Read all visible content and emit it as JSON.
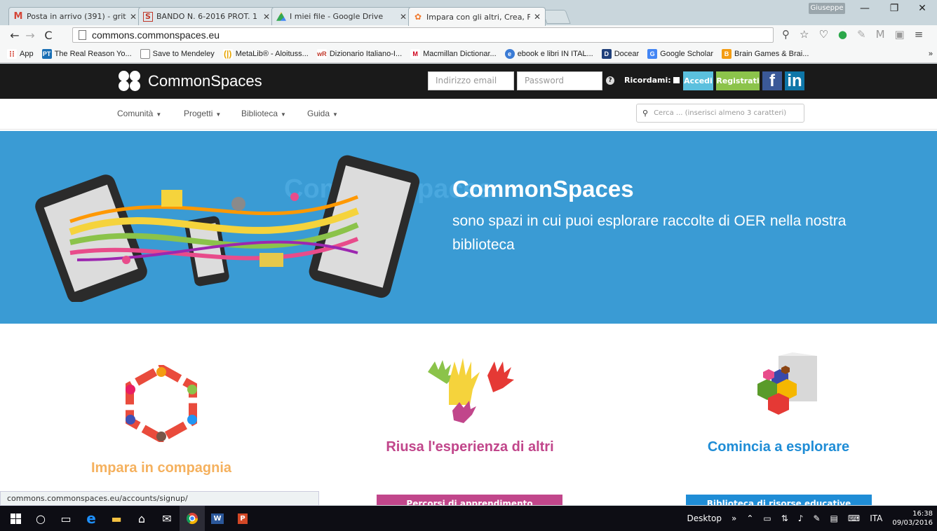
{
  "browser": {
    "tabs": [
      {
        "title": "Posta in arrivo (391) - gritt",
        "icon": "gmail-icon",
        "active": false
      },
      {
        "title": "BANDO N. 6-2016 PROT. 1",
        "icon": "s-doc-icon",
        "active": false
      },
      {
        "title": "I miei file - Google Drive",
        "icon": "google-drive-icon",
        "active": false
      },
      {
        "title": "Impara con gli altri, Crea, F",
        "icon": "commonspaces-icon",
        "active": true
      }
    ],
    "user": "Giuseppe",
    "window_controls": {
      "minimize": "—",
      "restore": "❐",
      "close": "✕"
    },
    "url": "commons.commonspaces.eu",
    "bookmarks": [
      {
        "label": "App",
        "icon": "apps-grid-icon",
        "color": "#d23f31"
      },
      {
        "label": "The Real Reason Yo...",
        "icon": "pt-icon",
        "color": "#1a6fb5"
      },
      {
        "label": "Save to Mendeley",
        "icon": "page-icon",
        "color": "#888888"
      },
      {
        "label": "MetaLib® - Aloituss...",
        "icon": "metalib-icon",
        "color": "#e6a500"
      },
      {
        "label": "Dizionario Italiano-I...",
        "icon": "wr-icon",
        "color": "#c0392b"
      },
      {
        "label": "Macmillan Dictionar...",
        "icon": "macmillan-icon",
        "color": "#d0021b"
      },
      {
        "label": "ebook e libri IN ITAL...",
        "icon": "ebook-icon",
        "color": "#3a7bd5"
      },
      {
        "label": "Docear",
        "icon": "docear-icon",
        "color": "#1f3f7a"
      },
      {
        "label": "Google Scholar",
        "icon": "scholar-icon",
        "color": "#4285f4"
      },
      {
        "label": "Brain Games & Brai...",
        "icon": "brain-games-icon",
        "color": "#f39c12"
      }
    ],
    "bookmarks_more": "»",
    "status_url": "commons.commonspaces.eu/accounts/signup/"
  },
  "site": {
    "logo_text": "CommonSpaces",
    "email_placeholder": "Indirizzo email",
    "password_placeholder": "Password",
    "help_mark": "?",
    "remember_label": "Ricordami:",
    "login_label": "Accedi",
    "register_label": "Registrati",
    "facebook_label": "f",
    "linkedin_label": "in",
    "nav": [
      "Comunità",
      "Progetti",
      "Biblioteca",
      "Guida"
    ],
    "search_placeholder": "Cerca ... (inserisci almeno 3 caratteri)"
  },
  "hero": {
    "title": "CommonSpaces",
    "ghost_title": "CommonSpaces",
    "subtitle": "sono spazi in cui puoi esplorare raccolte di OER nella nostra biblioteca"
  },
  "features": [
    {
      "title": "Impara in compagnia",
      "color": "#f5b15e",
      "button": "",
      "button_color": ""
    },
    {
      "title": "Riusa l'esperienza di altri",
      "color": "#c1468b",
      "button": "Percorsi di apprendimento",
      "button_color": "#c1468b"
    },
    {
      "title": "Comincia a esplorare",
      "color": "#1f8dd6",
      "button": "Biblioteca di risorse educative",
      "button_color": "#1f8dd6"
    }
  ],
  "taskbar": {
    "desktop_label": "Desktop",
    "chevron": "»",
    "language": "ITA",
    "time": "16:38",
    "date": "09/03/2016"
  }
}
